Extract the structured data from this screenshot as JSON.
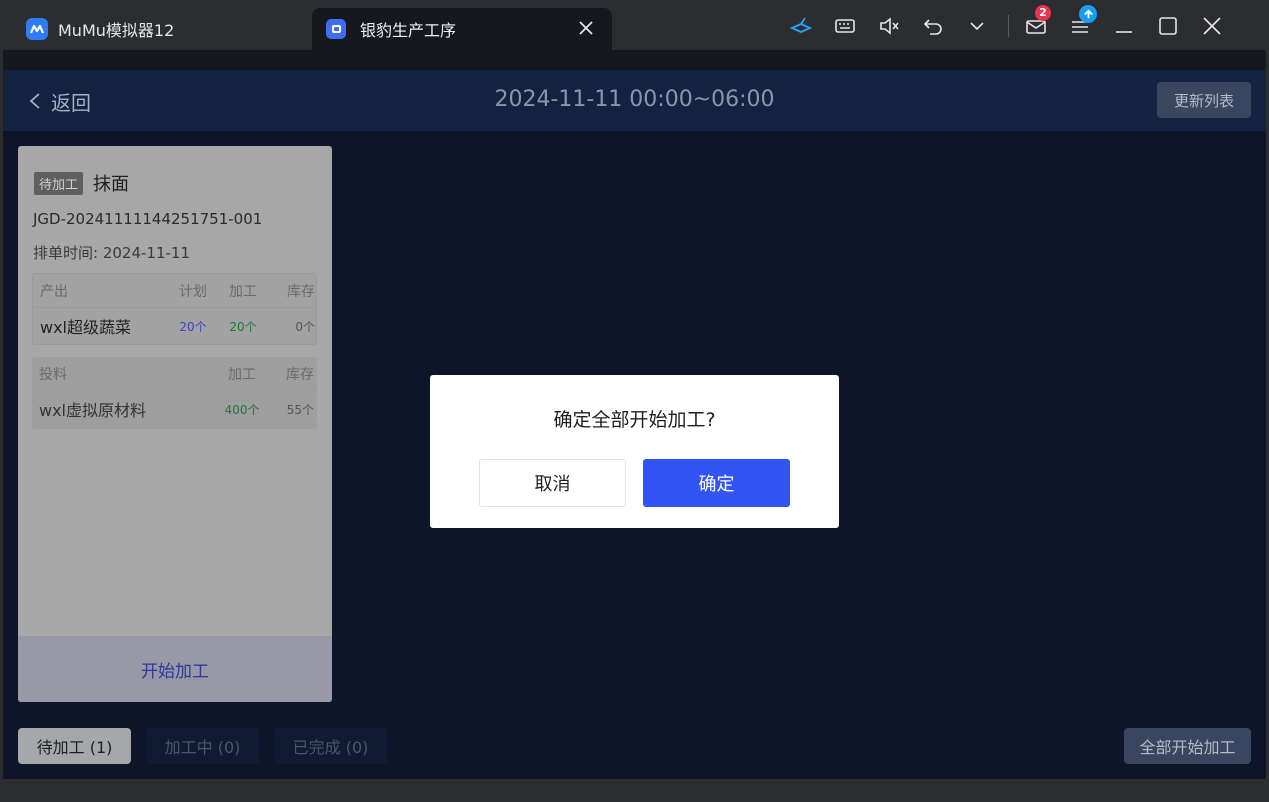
{
  "emulator": {
    "app_tab_label": "MuMu模拟器12",
    "active_tab_label": "银豹生产工序",
    "mail_badge": "2"
  },
  "header": {
    "back_label": "返回",
    "title": "2024-11-11 00:00~06:00",
    "refresh_label": "更新列表"
  },
  "card": {
    "status_tag": "待加工",
    "name": "抹面",
    "order_no": "JGD-20241111144251751-001",
    "schedule": "排单时间: 2024-11-11",
    "output": {
      "headers": [
        "产出",
        "计划",
        "加工",
        "库存"
      ],
      "row": {
        "name": "wxl超级蔬菜",
        "plan": "20个",
        "processed": "20个",
        "stock": "0个"
      }
    },
    "input": {
      "headers": [
        "投料",
        "加工",
        "库存"
      ],
      "row": {
        "name": "wxl虚拟原材料",
        "processed": "400个",
        "stock": "55个"
      }
    },
    "start_label": "开始加工"
  },
  "filters": {
    "pending": "待加工 (1)",
    "processing": "加工中 (0)",
    "done": "已完成 (0)"
  },
  "start_all_label": "全部开始加工",
  "modal": {
    "title": "确定全部开始加工?",
    "cancel_label": "取消",
    "confirm_label": "确定"
  },
  "colors": {
    "app_bg": "#0f1529",
    "header_bg": "#142242",
    "primary": "#3354f5",
    "badge": "#e8334e"
  }
}
